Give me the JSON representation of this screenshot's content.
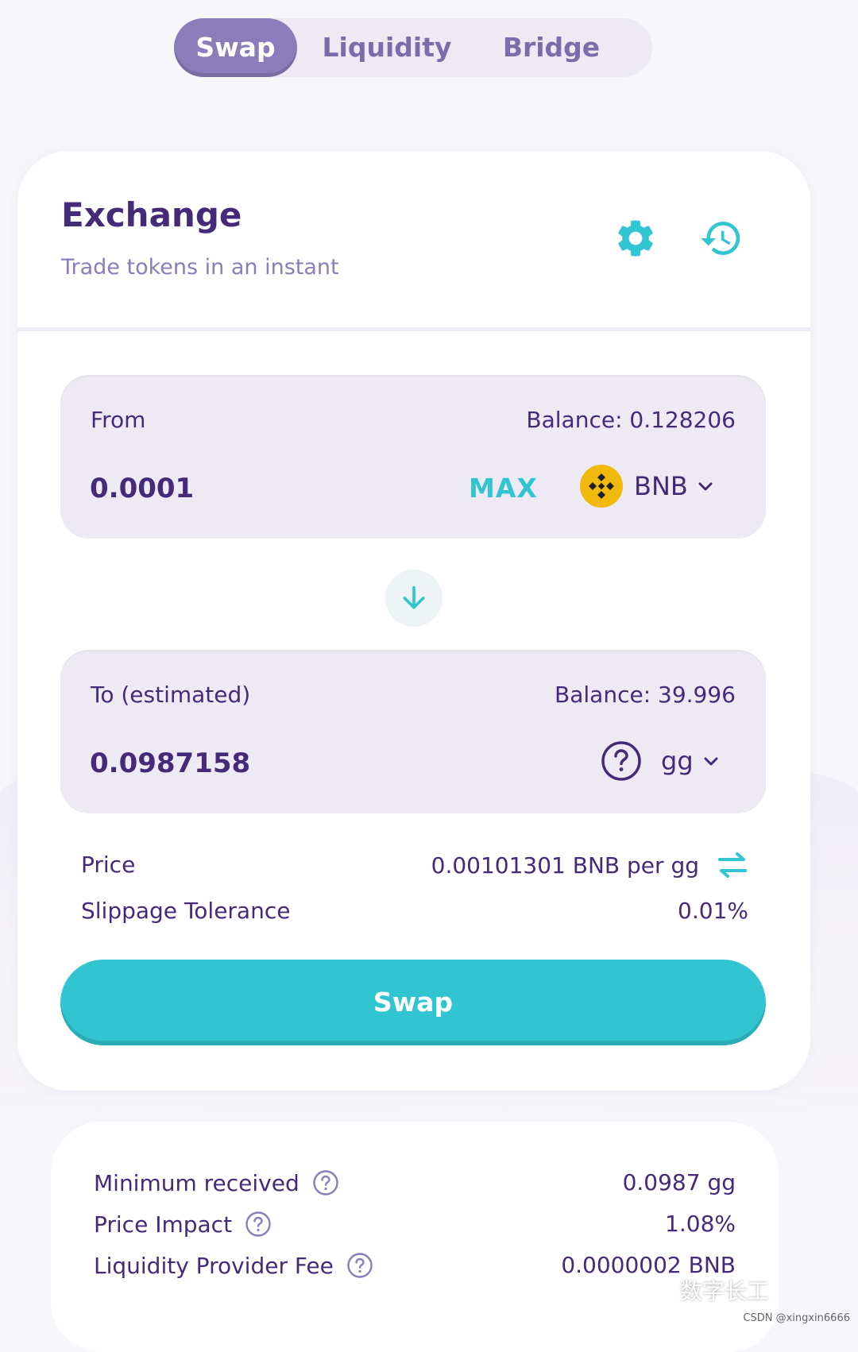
{
  "tabs": [
    {
      "label": "Swap",
      "active": true
    },
    {
      "label": "Liquidity",
      "active": false
    },
    {
      "label": "Bridge",
      "active": false
    }
  ],
  "exchange": {
    "title": "Exchange",
    "subtitle": "Trade tokens in an instant",
    "settings_icon": "gear-icon",
    "history_icon": "history-icon"
  },
  "from": {
    "label": "From",
    "balance": "Balance: 0.128206",
    "amount": "0.0001",
    "max_label": "MAX",
    "token": "BNB",
    "token_icon": "bnb-logo-icon"
  },
  "to": {
    "label": "To (estimated)",
    "balance": "Balance: 39.996",
    "amount": "0.0987158",
    "token": "gg",
    "token_icon": "unknown-token-icon"
  },
  "price": {
    "label": "Price",
    "value": "0.00101301 BNB per gg"
  },
  "slippage": {
    "label": "Slippage Tolerance",
    "value": "0.01%"
  },
  "swap_button": "Swap",
  "details": [
    {
      "label": "Minimum received",
      "value": "0.0987 gg"
    },
    {
      "label": "Price Impact",
      "value": "1.08%"
    },
    {
      "label": "Liquidity Provider Fee",
      "value": "0.0000002 BNB"
    }
  ],
  "watermark": {
    "text": "数字长工",
    "source": "CSDN @xingxin6666"
  },
  "colors": {
    "primary_text": "#452a7a",
    "secondary_text": "#8a7db9",
    "accent": "#31c5d2",
    "tab_active": "#8a7db9",
    "panel_bg": "#eeeaf4",
    "bnb_yellow": "#f0b90b"
  }
}
